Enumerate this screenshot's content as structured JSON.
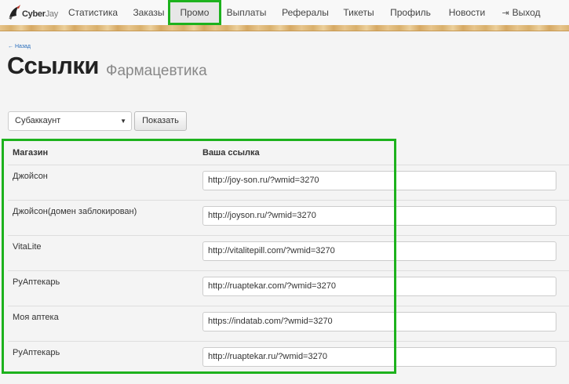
{
  "navbar": {
    "logo_bold": "Cyber",
    "logo_light": "Jay",
    "items": [
      {
        "label": "Статистика"
      },
      {
        "label": "Заказы"
      },
      {
        "label": "Промо"
      },
      {
        "label": "Выплаты"
      },
      {
        "label": "Рефералы"
      },
      {
        "label": "Тикеты"
      },
      {
        "label": "Профиль"
      },
      {
        "label": "Новости"
      },
      {
        "label": "Выход",
        "icon": "logout-icon"
      }
    ],
    "active_index": 2
  },
  "header": {
    "back_label": "← Назад",
    "title": "Ссылки",
    "subtitle": "Фармацевтика"
  },
  "filter": {
    "select_value": "Субаккаунт",
    "show_label": "Показать"
  },
  "table": {
    "columns": [
      "Магазин",
      "Ваша ссылка"
    ],
    "rows": [
      {
        "shop": "Джойсон",
        "link": "http://joy-son.ru/?wmid=3270"
      },
      {
        "shop": "Джойсон(домен заблокирован)",
        "link": "http://joyson.ru/?wmid=3270"
      },
      {
        "shop": "VitaLite",
        "link": "http://vitalitepill.com/?wmid=3270"
      },
      {
        "shop": "РуАптекарь",
        "link": "http://ruaptekar.com/?wmid=3270"
      },
      {
        "shop": "Моя аптека",
        "link": "https://indatab.com/?wmid=3270"
      },
      {
        "shop": "РуАптекарь",
        "link": "http://ruaptekar.ru/?wmid=3270"
      }
    ]
  },
  "colors": {
    "highlight": "#1db21d",
    "link": "#2a6ebb"
  }
}
